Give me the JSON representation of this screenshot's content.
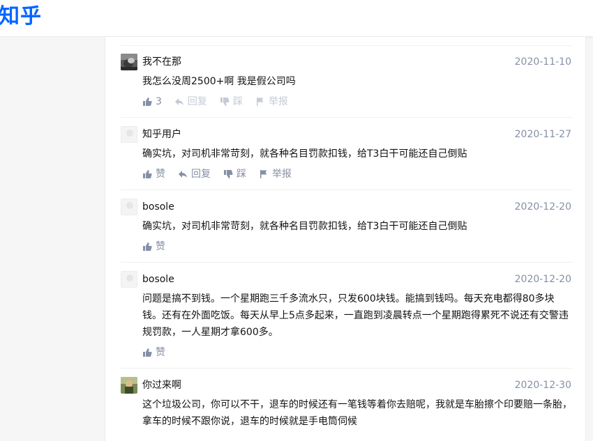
{
  "header": {
    "logo_text": "知乎"
  },
  "comments": [
    {
      "author": "我不在那",
      "date": "2020-11-10",
      "text": "我怎么没周2500+啊 我是假公司吗",
      "avatar": "photo",
      "actions": {
        "like": "3",
        "reply": "回复",
        "dislike": "踩",
        "report": "举报"
      }
    },
    {
      "author": "知乎用户",
      "date": "2020-11-27",
      "text": "确实坑，对司机非常苛刻，就各种名目罚款扣钱，给T3白干可能还自己倒贴",
      "avatar": "blank",
      "actions": {
        "like": "赞",
        "reply": "回复",
        "dislike": "踩",
        "report": "举报"
      }
    },
    {
      "author": "bosole",
      "date": "2020-12-20",
      "text": "确实坑，对司机非常苛刻，就各种名目罚款扣钱，给T3白干可能还自己倒贴",
      "avatar": "blank",
      "actions": {
        "like": "赞"
      }
    },
    {
      "author": "bosole",
      "date": "2020-12-20",
      "text": "问题是搞不到钱。一个星期跑三千多流水只，只发600块钱。能搞到钱吗。每天充电都得80多块钱。还有在外面吃饭。每天从早上5点多起来，一直跑到凌晨转点一个星期跑得累死不说还有交警违规罚款，一人星期才拿600多。",
      "avatar": "blank",
      "actions": {
        "like": "赞"
      }
    },
    {
      "author": "你过来啊",
      "date": "2020-12-30",
      "text": "这个垃圾公司，你可以不干，退车的时候还有一笔钱等着你去赔呢，我就是车胎擦个印要赔一条胎，拿车的时候不跟你说，退车的时候就是手电筒伺候",
      "avatar": "photo2",
      "actions": {}
    }
  ],
  "colors": {
    "brand": "#0066ff",
    "meta": "#8590a6",
    "muted": "#c5cad6",
    "border": "#ebebeb"
  }
}
